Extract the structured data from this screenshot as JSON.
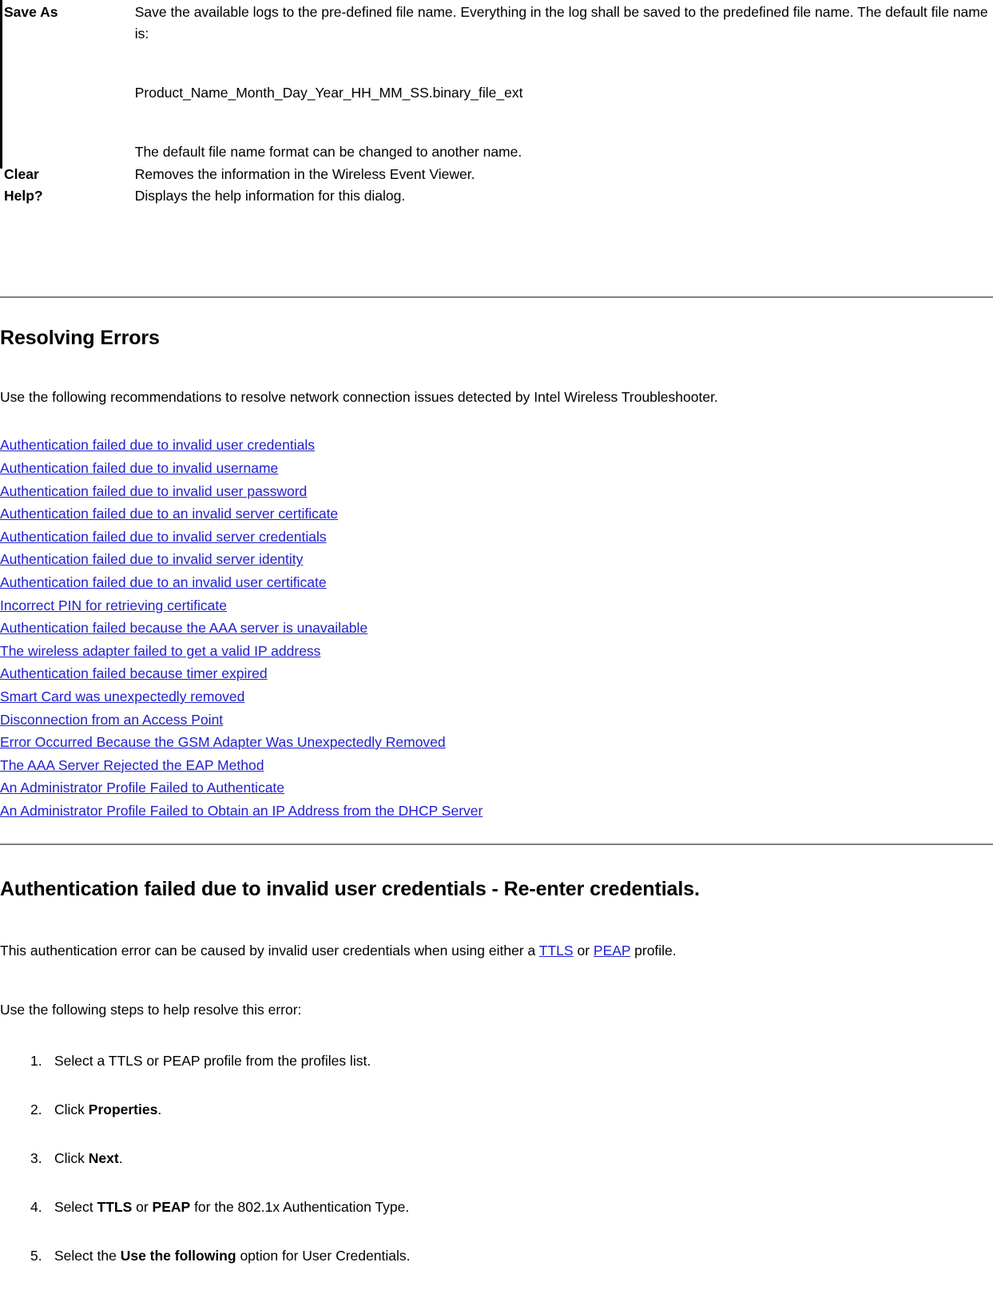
{
  "definition_table": {
    "rows": [
      {
        "term": "Save As",
        "description_lines": [
          "Save the available logs to the pre-defined file name. Everything in the log shall be saved to the predefined file name. The default file name is:",
          "Product_Name_Month_Day_Year_HH_MM_SS.binary_file_ext",
          "The default file name format can be changed to another name."
        ]
      },
      {
        "term": "Clear",
        "description_lines": [
          "Removes the information in the Wireless Event Viewer."
        ]
      },
      {
        "term": "Help?",
        "description_lines": [
          "Displays the help information for this dialog."
        ]
      }
    ]
  },
  "resolving_errors": {
    "heading": "Resolving Errors",
    "intro": "Use the following recommendations to resolve network connection issues detected by Intel Wireless Troubleshooter.",
    "links": [
      "Authentication failed due to invalid user credentials",
      "Authentication failed due to invalid username",
      "Authentication failed due to invalid user password",
      "Authentication failed due to an invalid server certificate",
      "Authentication failed due to invalid server credentials",
      "Authentication failed due to invalid server identity",
      "Authentication failed due to an invalid user certificate",
      "Incorrect PIN for retrieving certificate",
      "Authentication failed because the AAA server is unavailable",
      "The wireless adapter failed to get a valid IP address",
      "Authentication failed because timer expired",
      "Smart Card was unexpectedly removed",
      "Disconnection from an Access Point",
      "Error Occurred Because the GSM Adapter Was Unexpectedly Removed",
      "The AAA Server Rejected the EAP Method",
      "An Administrator Profile Failed to Authenticate",
      "An Administrator Profile Failed to Obtain an IP Address from the DHCP Server"
    ]
  },
  "auth_failed_section": {
    "heading": "Authentication failed due to invalid user credentials - Re-enter credentials.",
    "intro_part1": "This authentication error can be caused by invalid user credentials when using either a ",
    "intro_link_ttls": "TTLS",
    "intro_part2": " or ",
    "intro_link_peap": "PEAP",
    "intro_part3": " profile.",
    "steps_lead": "Use the following steps to help resolve this error:",
    "steps": [
      {
        "pre": "Select a TTLS or PEAP profile from the profiles list.",
        "bold": "",
        "mid": "",
        "bold2": "",
        "post": ""
      },
      {
        "pre": "Click ",
        "bold": "Properties",
        "mid": "",
        "bold2": "",
        "post": "."
      },
      {
        "pre": "Click ",
        "bold": "Next",
        "mid": "",
        "bold2": "",
        "post": "."
      },
      {
        "pre": "Select ",
        "bold": "TTLS",
        "mid": " or ",
        "bold2": "PEAP",
        "post": " for the 802.1x Authentication Type."
      },
      {
        "pre": "Select the ",
        "bold": "Use the following",
        "mid": "",
        "bold2": "",
        "post": " option for User Credentials."
      }
    ]
  },
  "colors": {
    "link": "#2020d0",
    "rule": "#808080",
    "text": "#000000",
    "background": "#ffffff"
  }
}
